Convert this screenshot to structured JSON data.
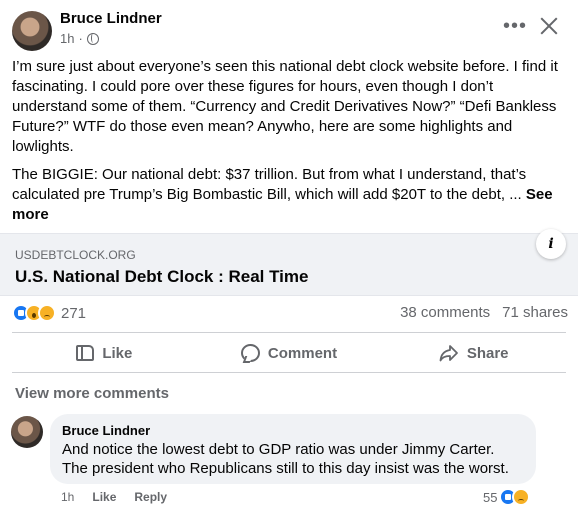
{
  "post": {
    "author": "Bruce Lindner",
    "time": "1h",
    "separator": "·",
    "paragraph1": "I’m sure just about everyone’s seen this national debt clock website before. I find it fascinating. I could pore over these figures for hours, even though I don’t understand some of them. “Currency and Credit Derivatives Now?” “Defi Bankless Future?” WTF do those even mean? Anywho, here are some highlights and lowlights.",
    "paragraph2": "The BIGGIE: Our national debt: $37 trillion. But from what I understand, that’s calculated pre Trump’s Big Bombastic Bill, which will add $20T to the debt, ... ",
    "see_more": "See more",
    "more_icon": "more-dots-icon",
    "close_icon": "close-icon"
  },
  "link_card": {
    "domain": "USDEBTCLOCK.ORG",
    "title": "U.S. National Debt Clock : Real Time",
    "info_label": "i"
  },
  "stats": {
    "reaction_count": "271",
    "comments": "38 comments",
    "shares": "71 shares",
    "reaction_icons": [
      "like-icon",
      "wow-icon",
      "sad-icon"
    ]
  },
  "actions": {
    "like": "Like",
    "comment": "Comment",
    "share": "Share"
  },
  "comments_section": {
    "view_more": "View more comments",
    "comment": {
      "author": "Bruce Lindner",
      "text": "And notice the lowest debt to GDP ratio was under Jimmy Carter. The president who Republicans still to this day insist was the worst.",
      "time": "1h",
      "like": "Like",
      "reply": "Reply",
      "reaction_count": "55"
    }
  },
  "colors": {
    "brand_blue": "#1877f2",
    "secondary_text": "#65676b",
    "card_bg": "#f0f2f5"
  }
}
